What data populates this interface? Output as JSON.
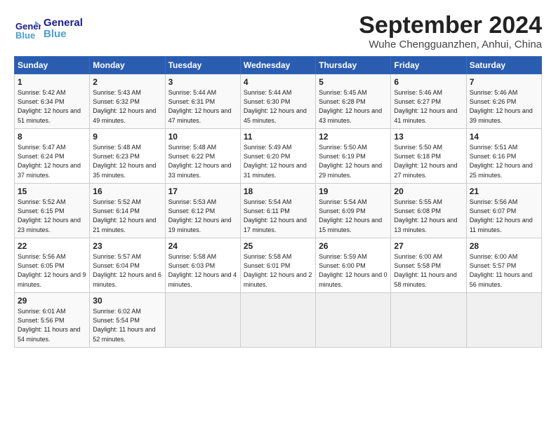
{
  "header": {
    "logo_line1": "General",
    "logo_line2": "Blue",
    "title": "September 2024",
    "subtitle": "Wuhe Chengguanzhen, Anhui, China"
  },
  "weekdays": [
    "Sunday",
    "Monday",
    "Tuesday",
    "Wednesday",
    "Thursday",
    "Friday",
    "Saturday"
  ],
  "weeks": [
    [
      {
        "day": "1",
        "sunrise": "5:42 AM",
        "sunset": "6:34 PM",
        "daylight": "12 hours and 51 minutes."
      },
      {
        "day": "2",
        "sunrise": "5:43 AM",
        "sunset": "6:32 PM",
        "daylight": "12 hours and 49 minutes."
      },
      {
        "day": "3",
        "sunrise": "5:44 AM",
        "sunset": "6:31 PM",
        "daylight": "12 hours and 47 minutes."
      },
      {
        "day": "4",
        "sunrise": "5:44 AM",
        "sunset": "6:30 PM",
        "daylight": "12 hours and 45 minutes."
      },
      {
        "day": "5",
        "sunrise": "5:45 AM",
        "sunset": "6:28 PM",
        "daylight": "12 hours and 43 minutes."
      },
      {
        "day": "6",
        "sunrise": "5:46 AM",
        "sunset": "6:27 PM",
        "daylight": "12 hours and 41 minutes."
      },
      {
        "day": "7",
        "sunrise": "5:46 AM",
        "sunset": "6:26 PM",
        "daylight": "12 hours and 39 minutes."
      }
    ],
    [
      {
        "day": "8",
        "sunrise": "5:47 AM",
        "sunset": "6:24 PM",
        "daylight": "12 hours and 37 minutes."
      },
      {
        "day": "9",
        "sunrise": "5:48 AM",
        "sunset": "6:23 PM",
        "daylight": "12 hours and 35 minutes."
      },
      {
        "day": "10",
        "sunrise": "5:48 AM",
        "sunset": "6:22 PM",
        "daylight": "12 hours and 33 minutes."
      },
      {
        "day": "11",
        "sunrise": "5:49 AM",
        "sunset": "6:20 PM",
        "daylight": "12 hours and 31 minutes."
      },
      {
        "day": "12",
        "sunrise": "5:50 AM",
        "sunset": "6:19 PM",
        "daylight": "12 hours and 29 minutes."
      },
      {
        "day": "13",
        "sunrise": "5:50 AM",
        "sunset": "6:18 PM",
        "daylight": "12 hours and 27 minutes."
      },
      {
        "day": "14",
        "sunrise": "5:51 AM",
        "sunset": "6:16 PM",
        "daylight": "12 hours and 25 minutes."
      }
    ],
    [
      {
        "day": "15",
        "sunrise": "5:52 AM",
        "sunset": "6:15 PM",
        "daylight": "12 hours and 23 minutes."
      },
      {
        "day": "16",
        "sunrise": "5:52 AM",
        "sunset": "6:14 PM",
        "daylight": "12 hours and 21 minutes."
      },
      {
        "day": "17",
        "sunrise": "5:53 AM",
        "sunset": "6:12 PM",
        "daylight": "12 hours and 19 minutes."
      },
      {
        "day": "18",
        "sunrise": "5:54 AM",
        "sunset": "6:11 PM",
        "daylight": "12 hours and 17 minutes."
      },
      {
        "day": "19",
        "sunrise": "5:54 AM",
        "sunset": "6:09 PM",
        "daylight": "12 hours and 15 minutes."
      },
      {
        "day": "20",
        "sunrise": "5:55 AM",
        "sunset": "6:08 PM",
        "daylight": "12 hours and 13 minutes."
      },
      {
        "day": "21",
        "sunrise": "5:56 AM",
        "sunset": "6:07 PM",
        "daylight": "12 hours and 11 minutes."
      }
    ],
    [
      {
        "day": "22",
        "sunrise": "5:56 AM",
        "sunset": "6:05 PM",
        "daylight": "12 hours and 9 minutes."
      },
      {
        "day": "23",
        "sunrise": "5:57 AM",
        "sunset": "6:04 PM",
        "daylight": "12 hours and 6 minutes."
      },
      {
        "day": "24",
        "sunrise": "5:58 AM",
        "sunset": "6:03 PM",
        "daylight": "12 hours and 4 minutes."
      },
      {
        "day": "25",
        "sunrise": "5:58 AM",
        "sunset": "6:01 PM",
        "daylight": "12 hours and 2 minutes."
      },
      {
        "day": "26",
        "sunrise": "5:59 AM",
        "sunset": "6:00 PM",
        "daylight": "12 hours and 0 minutes."
      },
      {
        "day": "27",
        "sunrise": "6:00 AM",
        "sunset": "5:58 PM",
        "daylight": "11 hours and 58 minutes."
      },
      {
        "day": "28",
        "sunrise": "6:00 AM",
        "sunset": "5:57 PM",
        "daylight": "11 hours and 56 minutes."
      }
    ],
    [
      {
        "day": "29",
        "sunrise": "6:01 AM",
        "sunset": "5:56 PM",
        "daylight": "11 hours and 54 minutes."
      },
      {
        "day": "30",
        "sunrise": "6:02 AM",
        "sunset": "5:54 PM",
        "daylight": "11 hours and 52 minutes."
      },
      null,
      null,
      null,
      null,
      null
    ]
  ]
}
